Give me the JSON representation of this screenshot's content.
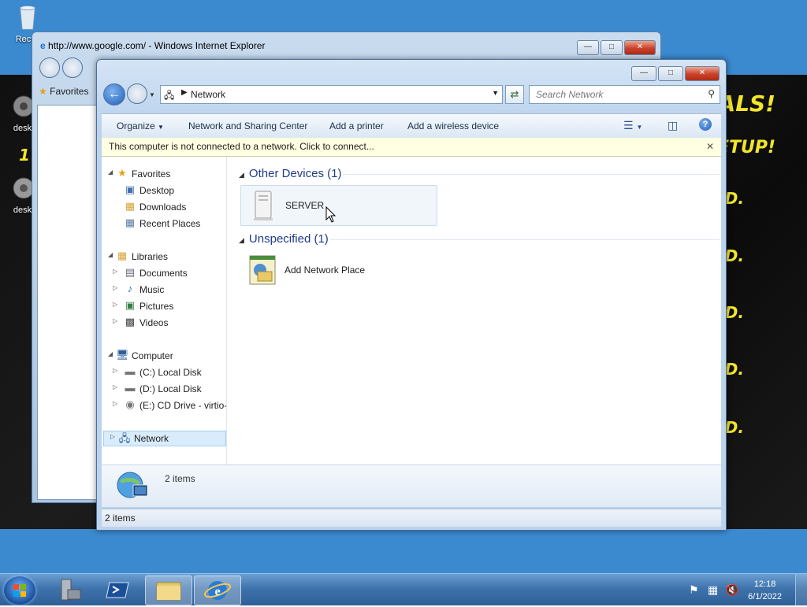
{
  "desktop": {
    "icons": [
      "Recyc",
      "deskt",
      "deskt"
    ],
    "wallpaper_text": [
      "ALS!",
      "ETUP!",
      "D.",
      "D.",
      "D.",
      "D.",
      "D.",
      "D."
    ],
    "wallpaper_number": "1"
  },
  "ie_window": {
    "title": "http://www.google.com/ - Windows Internet Explorer",
    "favorites_label": "Favorites"
  },
  "explorer": {
    "address": {
      "location": "Network"
    },
    "search": {
      "placeholder": "Search Network"
    },
    "toolbar": {
      "organize": "Organize",
      "network_sharing_center": "Network and Sharing Center",
      "add_printer": "Add a printer",
      "add_wireless_device": "Add a wireless device"
    },
    "infobar": {
      "text": "This computer is not connected to a network. Click to connect..."
    },
    "nav": {
      "favorites": "Favorites",
      "desktop": "Desktop",
      "downloads": "Downloads",
      "recent_places": "Recent Places",
      "libraries": "Libraries",
      "documents": "Documents",
      "music": "Music",
      "pictures": "Pictures",
      "videos": "Videos",
      "computer": "Computer",
      "drive_c": "(C:) Local Disk",
      "drive_d": "(D:) Local Disk",
      "drive_e": "(E:) CD Drive - virtio-",
      "network": "Network"
    },
    "groups": [
      {
        "header": "Other Devices (1)",
        "item": "SERVER"
      },
      {
        "header": "Unspecified (1)",
        "item": "Add Network Place"
      }
    ],
    "details": {
      "count": "2 items"
    },
    "status": {
      "count": "2 items"
    }
  },
  "taskbar": {
    "clock": {
      "time": "12:18",
      "date": "6/1/2022"
    }
  }
}
